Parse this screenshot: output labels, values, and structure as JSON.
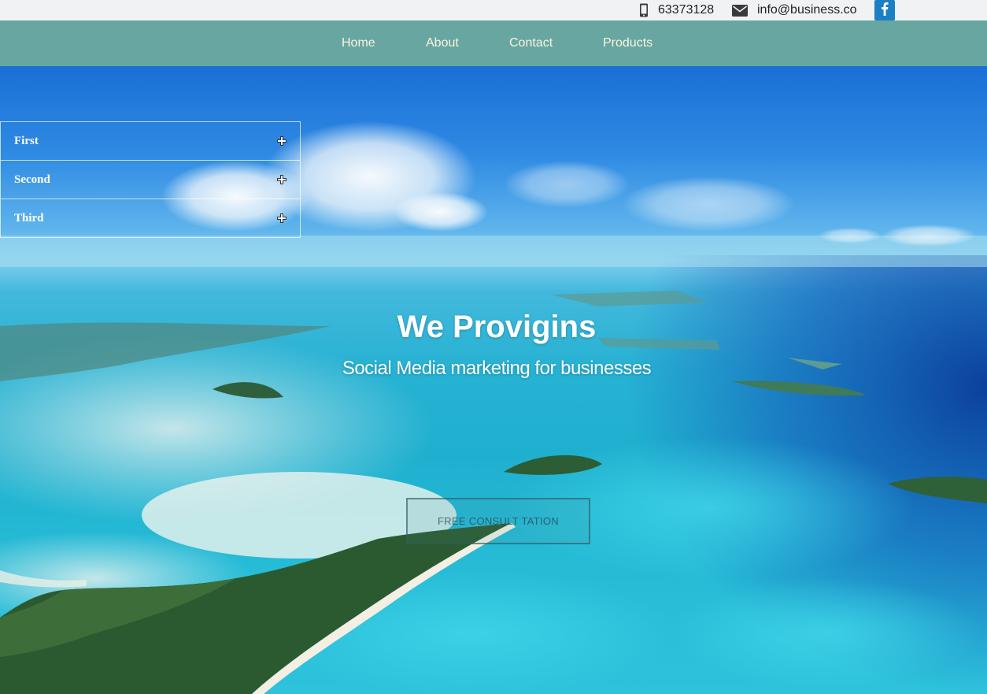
{
  "topbar": {
    "phone": "63373128",
    "phone_icon": "mobile-phone-icon",
    "email": "info@business.co",
    "email_icon": "envelope-icon",
    "social_icon": "facebook-icon"
  },
  "nav": {
    "items": [
      {
        "label": "Home"
      },
      {
        "label": "About"
      },
      {
        "label": "Contact"
      },
      {
        "label": "Products"
      }
    ]
  },
  "accordion": {
    "items": [
      {
        "label": "First",
        "icon": "plus-icon"
      },
      {
        "label": "Second",
        "icon": "plus-icon"
      },
      {
        "label": "Third",
        "icon": "plus-icon"
      }
    ]
  },
  "hero": {
    "title": "We Provigins",
    "subtitle": "Social Media marketing for businesses",
    "cta_label": "FREE CONSULT TATION"
  },
  "colors": {
    "topbar_bg": "#f1f2f4",
    "nav_bg": "#68a7a1",
    "nav_text": "#fbf3dc",
    "facebook_blue": "#1b7fc4",
    "sky_blue": "#1a6fd6",
    "lagoon_turquoise": "#27b2d3"
  }
}
